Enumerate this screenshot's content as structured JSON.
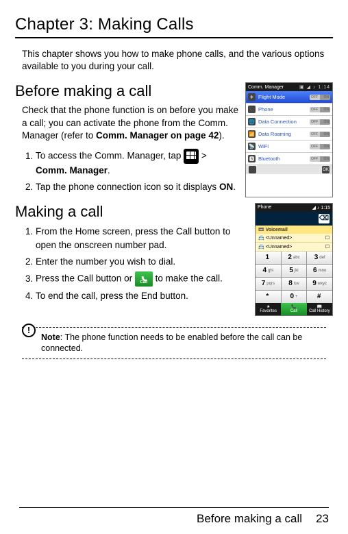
{
  "chapterTitle": "Chapter 3: Making Calls",
  "chapterIntro": "This chapter shows you how to make phone calls, and the various options available to you during your call.",
  "sec1": {
    "heading": "Before making a call",
    "para": "Check that the phone function is on before you make a call; you can activate the phone from the Comm. Manager (refer to ",
    "paraBoldRef": "Comm. Manager on page 42",
    "paraAfter": ").",
    "step1_pre": "To access the Comm. Manager, tap ",
    "step1_bold": "Comm. Manager",
    "step1_gt": ">",
    "step1_end": ".",
    "step2_pre": "Tap the phone connection icon so it displays ",
    "step2_bold": "ON",
    "step2_end": "."
  },
  "sec2": {
    "heading": "Making a call",
    "s1": "From the Home screen, press the Call button to open the onscreen number pad.",
    "s2": "Enter the number you wish to dial.",
    "s3_pre": "Press the Call button or ",
    "s3_post": " to make the call.",
    "s4": "To end the call, press the End button."
  },
  "callBtnLabel": "Call",
  "note": {
    "label": "Note",
    "text": ": The phone function needs to be enabled before the call can be connected."
  },
  "footer": {
    "text": "Before making a call",
    "page": "23"
  },
  "commScreen": {
    "title": "Comm. Manager",
    "clock": "1:14",
    "rows": [
      {
        "icon": "✈",
        "label": "Flight Mode",
        "on": "ON",
        "off": "OFF"
      },
      {
        "icon": "📞",
        "label": "Phone",
        "on": "ON",
        "off": "OFF"
      },
      {
        "icon": "🌐",
        "label": "Data Connection",
        "on": "ON",
        "off": "OFF"
      },
      {
        "icon": "📶",
        "label": "Data Roaming",
        "on": "ON",
        "off": "OFF"
      },
      {
        "icon": "📡",
        "label": "WiFi",
        "on": "ON",
        "off": "OFF"
      },
      {
        "icon": "🅱",
        "label": "Bluetooth",
        "on": "ON",
        "off": "OFF"
      }
    ]
  },
  "phoneScreen": {
    "title": "Phone",
    "clock": "1:15",
    "voicemail": "Voicemail",
    "unnamed": "<Unnamed>",
    "keys": [
      {
        "n": "1",
        "s": ""
      },
      {
        "n": "2",
        "s": "abc"
      },
      {
        "n": "3",
        "s": "def"
      },
      {
        "n": "4",
        "s": "ghi"
      },
      {
        "n": "5",
        "s": "jkl"
      },
      {
        "n": "6",
        "s": "mno"
      },
      {
        "n": "7",
        "s": "pqrs"
      },
      {
        "n": "8",
        "s": "tuv"
      },
      {
        "n": "9",
        "s": "wxyz"
      },
      {
        "n": "*",
        "s": ""
      },
      {
        "n": "0",
        "s": "+"
      },
      {
        "n": "#",
        "s": ""
      }
    ],
    "bottom": {
      "fav": "Favorites",
      "call": "Call",
      "hist": "Call History"
    },
    "bksp": "⌫"
  }
}
